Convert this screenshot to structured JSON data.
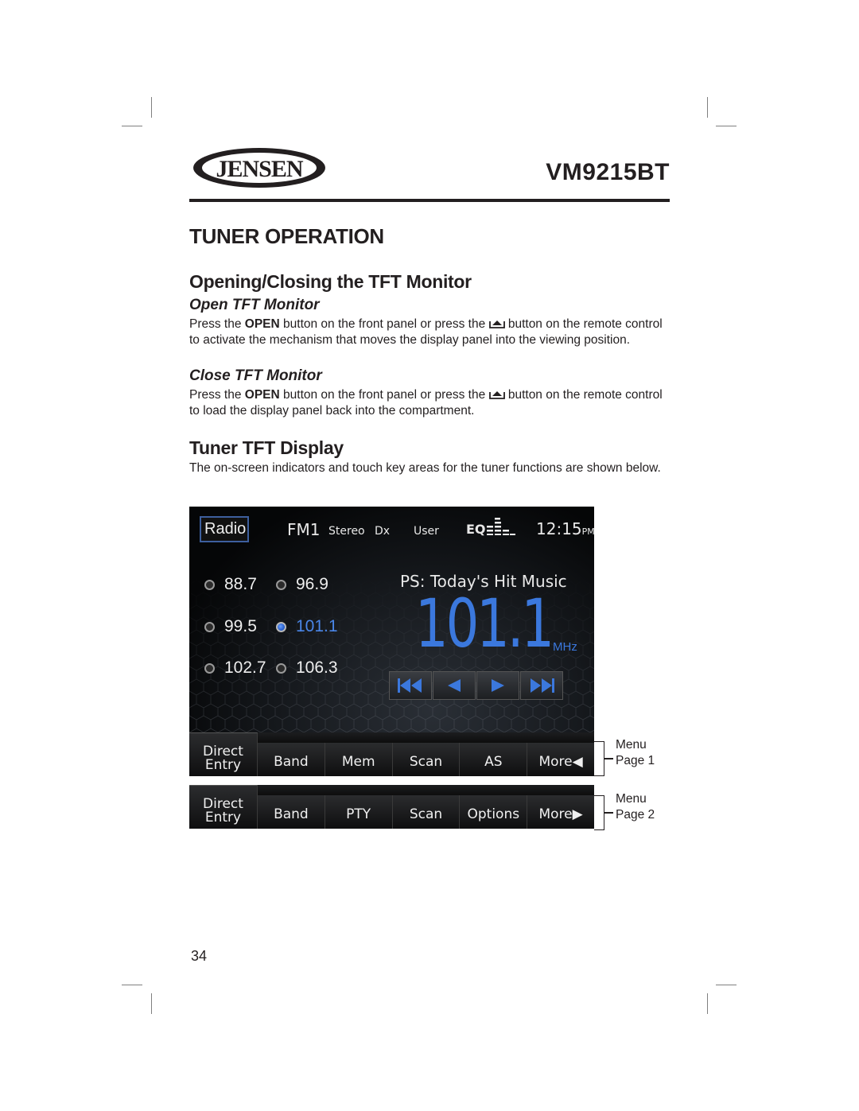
{
  "header": {
    "brand": "JENSEN",
    "model": "VM9215BT"
  },
  "section_title": "TUNER OPERATION",
  "opening_closing": {
    "heading": "Opening/Closing the TFT Monitor",
    "open": {
      "subheading": "Open TFT Monitor",
      "text_before": "Press the ",
      "bold": "OPEN",
      "text_mid": " button on the front panel or press the ",
      "icon": "eject-icon",
      "text_after": " button on the remote control to activate the mechanism that moves the display panel into the viewing position."
    },
    "close": {
      "subheading": "Close TFT Monitor",
      "text_before": "Press the ",
      "bold": "OPEN",
      "text_mid": " button on the front panel or press the ",
      "icon": "eject-icon",
      "text_after": " button on the remote control to load the display panel back into the compartment."
    }
  },
  "tuner_display": {
    "heading": "Tuner TFT Display",
    "description": "The on-screen indicators and touch key areas for the tuner functions are shown below."
  },
  "tft": {
    "source_button": "Radio",
    "band": "FM1",
    "stereo": "Stereo",
    "dx": "Dx",
    "eq_preset": "User",
    "eq_label": "EQ",
    "clock_time": "12:15",
    "clock_ampm": "PM",
    "presets": [
      {
        "freq": "88.7",
        "active": false
      },
      {
        "freq": "96.9",
        "active": false
      },
      {
        "freq": "99.5",
        "active": false
      },
      {
        "freq": "101.1",
        "active": true
      },
      {
        "freq": "102.7",
        "active": false
      },
      {
        "freq": "106.3",
        "active": false
      }
    ],
    "ps_text": "PS: Today's Hit Music",
    "frequency": "101.1",
    "unit": "MHz",
    "controls": [
      "seek-back-icon",
      "tune-down-icon",
      "tune-up-icon",
      "seek-forward-icon"
    ],
    "accent_color": "#3b78dd"
  },
  "menu_page1": {
    "buttons": [
      "Direct Entry",
      "Band",
      "Mem",
      "Scan",
      "AS",
      "More◀"
    ],
    "direct_line1": "Direct",
    "direct_line2": "Entry",
    "callout_line1": "Menu",
    "callout_line2": "Page 1"
  },
  "menu_page2": {
    "buttons": [
      "Direct Entry",
      "Band",
      "PTY",
      "Scan",
      "Options",
      "More▶"
    ],
    "direct_line1": "Direct",
    "direct_line2": "Entry",
    "callout_line1": "Menu",
    "callout_line2": "Page 2"
  },
  "page_number": "34"
}
